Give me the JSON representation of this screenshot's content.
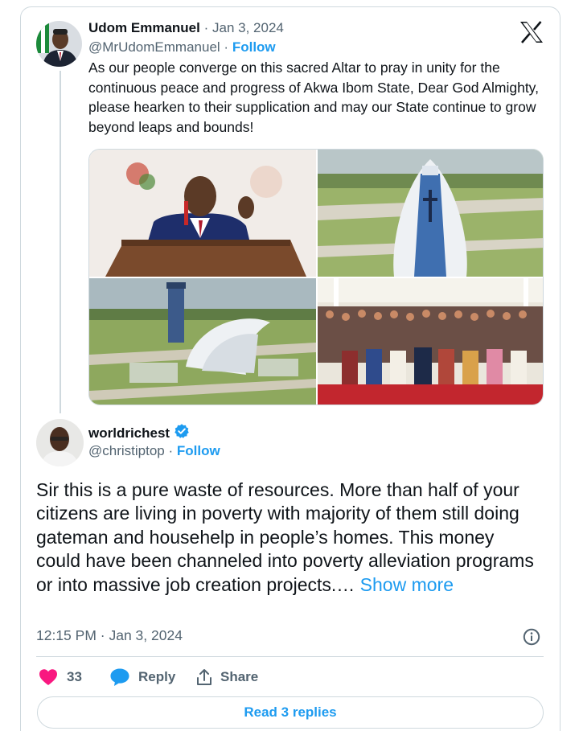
{
  "quoted_tweet": {
    "author_name": "Udom Emmanuel",
    "date": "Jan 3, 2024",
    "handle": "@MrUdomEmmanuel",
    "follow_label": "Follow",
    "text": "As our people converge on this sacred Altar to pray in unity for the continuous peace and progress of Akwa Ibom State, Dear God Almighty, please hearken to their supplication and may our State continue to grow beyond leaps and bounds!",
    "media": [
      {
        "icon": "photo-speaker-at-podium"
      },
      {
        "icon": "photo-aerial-cathedral"
      },
      {
        "icon": "photo-aerial-tower-and-cathedral"
      },
      {
        "icon": "photo-congregation"
      }
    ]
  },
  "reply_tweet": {
    "author_name": "worldrichest",
    "verified": true,
    "handle": "@christiptop",
    "follow_label": "Follow",
    "text": "Sir this is a pure waste of resources. More than half of your citizens are living in poverty with majority of them still doing gateman and househelp in people’s homes. This money could have been channeled into poverty alleviation programs or into massive job creation projects.…",
    "show_more_label": "Show more",
    "timestamp": "12:15 PM · Jan 3, 2024",
    "likes": "33",
    "reply_label": "Reply",
    "share_label": "Share",
    "read_replies_label": "Read 3 replies"
  },
  "colors": {
    "accent": "#1d9bf0",
    "like": "#f91880",
    "muted": "#536471",
    "border": "#cfd9de"
  },
  "separator": "·"
}
